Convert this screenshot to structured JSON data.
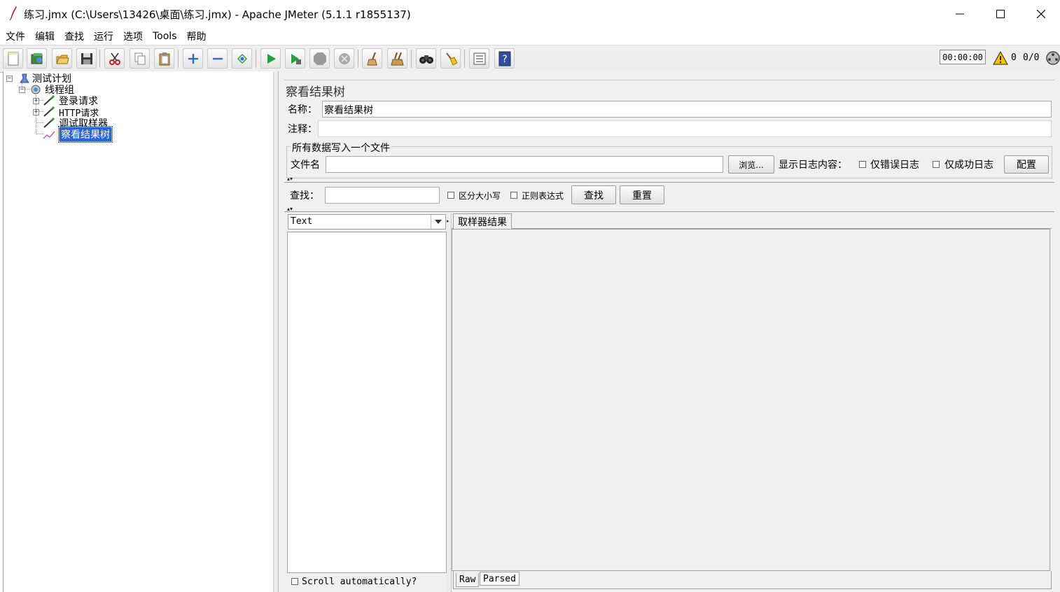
{
  "window": {
    "title": "练习.jmx (C:\\Users\\13426\\桌面\\练习.jmx) - Apache JMeter (5.1.1 r1855137)",
    "minimize_glyph": "—",
    "maximize_glyph": "☐",
    "close_glyph": "✕"
  },
  "menu": [
    "文件",
    "编辑",
    "查找",
    "运行",
    "选项",
    "Tools",
    "帮助"
  ],
  "toolbar": {
    "icons": [
      "new-icon",
      "templates-icon",
      "open-icon",
      "save-icon",
      "cut-icon",
      "copy-icon",
      "paste-icon",
      "expand-icon",
      "collapse-icon",
      "toggle-icon",
      "start-icon",
      "start-no-pause-icon",
      "stop-icon",
      "shutdown-icon",
      "clear-icon",
      "clear-all-icon",
      "search-icon",
      "reset-search-icon",
      "function-helper-icon",
      "help-icon"
    ],
    "timer": "00:00:00",
    "warning_count": "0",
    "thread_count": "0/0"
  },
  "tree": {
    "test_plan": "测试计划",
    "thread_group": "线程组",
    "children": [
      "登录请求",
      "HTTP请求",
      "调试取样器",
      "察看结果树"
    ],
    "selected_index": 3
  },
  "panel": {
    "title": "察看结果树",
    "name_label": "名称：",
    "name_value": "察看结果树",
    "comment_label": "注释：",
    "comment_value": "",
    "file_group_title": "所有数据写入一个文件",
    "filename_label": "文件名",
    "filename_value": "",
    "browse_button": "浏览...",
    "log_display_label": "显示日志内容：",
    "errors_only_label": "仅错误日志",
    "success_only_label": "仅成功日志",
    "configure_button": "配置",
    "search_label": "查找：",
    "search_value": "",
    "case_sensitive_label": "区分大小写",
    "regex_label": "正则表达式",
    "search_button": "查找",
    "reset_button": "重置",
    "renderer_selected": "Text",
    "result_tab": "取样器结果",
    "scroll_auto_label": "Scroll automatically?",
    "bottom_tabs": [
      "Raw",
      "Parsed"
    ]
  }
}
